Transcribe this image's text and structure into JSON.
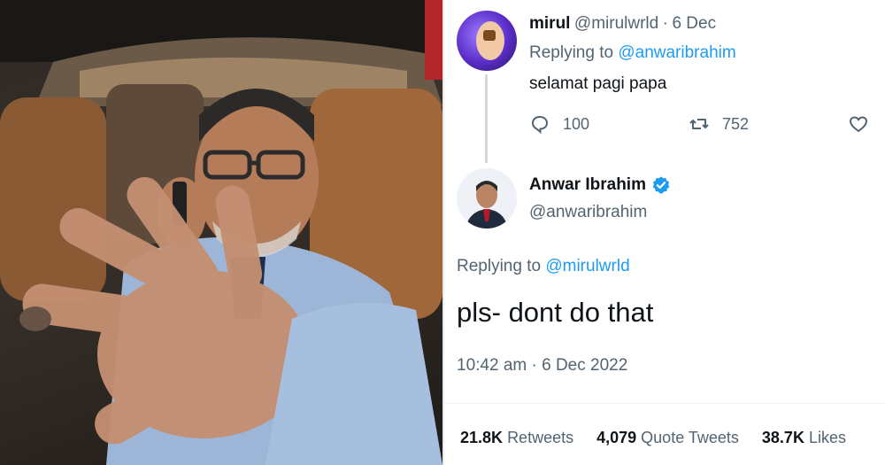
{
  "photo": {
    "description_icon": "person-in-car-photo-icon"
  },
  "tweet1": {
    "name": "mirul",
    "handle": "@mirulwrld",
    "separator": "·",
    "date": "6 Dec",
    "replying_prefix": "Replying to",
    "replying_to": "@anwaribrahim",
    "text": "selamat pagi papa",
    "replies": "100",
    "retweets": "752"
  },
  "tweet2": {
    "name": "Anwar Ibrahim",
    "handle": "@anwaribrahim",
    "replying_prefix": "Replying to",
    "replying_to": "@mirulwrld",
    "text": "pls- dont do that",
    "timestamp": "10:42 am · 6 Dec 2022",
    "stats": {
      "retweets_count": "21.8K",
      "retweets_label": "Retweets",
      "quotes_count": "4,079",
      "quotes_label": "Quote Tweets",
      "likes_count": "38.7K",
      "likes_label": "Likes"
    }
  },
  "colors": {
    "link": "#1d9bf0",
    "muted": "#536471",
    "text": "#0f1419",
    "verified": "#1d9bf0"
  }
}
